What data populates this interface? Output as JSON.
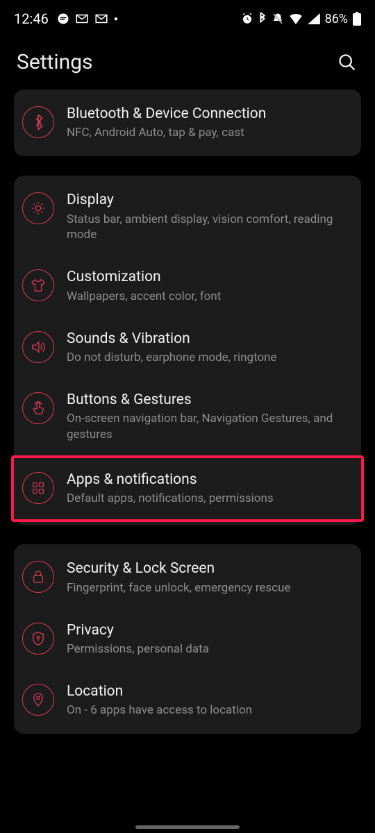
{
  "status": {
    "time": "12:46",
    "battery": "86%"
  },
  "header": {
    "title": "Settings"
  },
  "groups": [
    {
      "items": [
        {
          "icon": "bluetooth",
          "title": "Bluetooth & Device Connection",
          "sub": "NFC, Android Auto, tap & pay, cast"
        }
      ]
    },
    {
      "items": [
        {
          "icon": "display",
          "title": "Display",
          "sub": "Status bar, ambient display, vision comfort, reading mode"
        },
        {
          "icon": "shirt",
          "title": "Customization",
          "sub": "Wallpapers, accent color, font"
        },
        {
          "icon": "sound",
          "title": "Sounds & Vibration",
          "sub": "Do not disturb, earphone mode, ringtone"
        },
        {
          "icon": "touch",
          "title": "Buttons & Gestures",
          "sub": "On-screen navigation bar, Navigation Gestures, and gestures"
        },
        {
          "icon": "apps",
          "title": "Apps & notifications",
          "sub": "Default apps, notifications, permissions",
          "highlight": true
        }
      ]
    },
    {
      "items": [
        {
          "icon": "lock",
          "title": "Security & Lock Screen",
          "sub": "Fingerprint, face unlock, emergency rescue"
        },
        {
          "icon": "privacy",
          "title": "Privacy",
          "sub": "Permissions, personal data"
        },
        {
          "icon": "location",
          "title": "Location",
          "sub": "On - 6 apps have access to location"
        }
      ]
    }
  ]
}
